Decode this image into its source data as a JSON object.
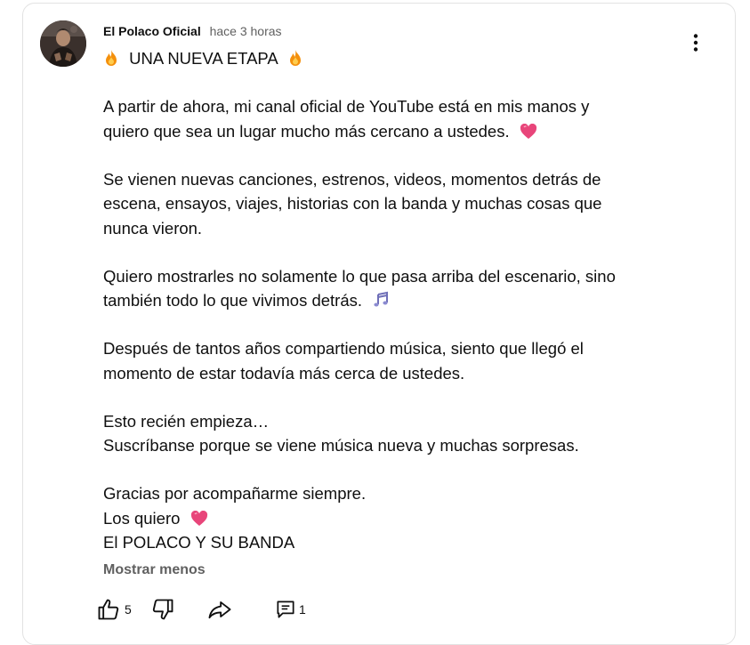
{
  "post": {
    "author": "El Polaco Oficial",
    "time": "hace 3 horas",
    "title": "UNA NUEVA ETAPA",
    "lines": [
      "A partir de ahora, mi canal oficial de YouTube está en mis manos y",
      "quiero que sea un lugar mucho más cercano a ustedes.",
      "Se vienen nuevas canciones, estrenos, videos, momentos detrás de",
      "escena, ensayos, viajes, historias con la banda y muchas cosas que",
      "nunca vieron.",
      "Quiero mostrarles no solamente lo que pasa arriba del escenario, sino",
      "también todo lo que vivimos detrás.",
      "Después de tantos años compartiendo música, siento que llegó el",
      "momento de estar todavía más cerca de ustedes.",
      "Esto recién empieza…",
      "Suscríbanse porque se viene música nueva y muchas sorpresas.",
      "Gracias por acompañarme siempre.",
      "Los quiero",
      "El POLACO Y SU BANDA"
    ],
    "show_less_label": "Mostrar menos"
  },
  "actions": {
    "like_count": "5",
    "comment_count": "1"
  },
  "icons": {
    "fire": "fire-emoji-icon",
    "heart": "heart-emoji-icon",
    "music": "music-notes-emoji-icon",
    "more": "more-vert-icon",
    "like": "thumb-up-icon",
    "dislike": "thumb-down-icon",
    "share": "share-icon",
    "comment": "comment-icon"
  }
}
